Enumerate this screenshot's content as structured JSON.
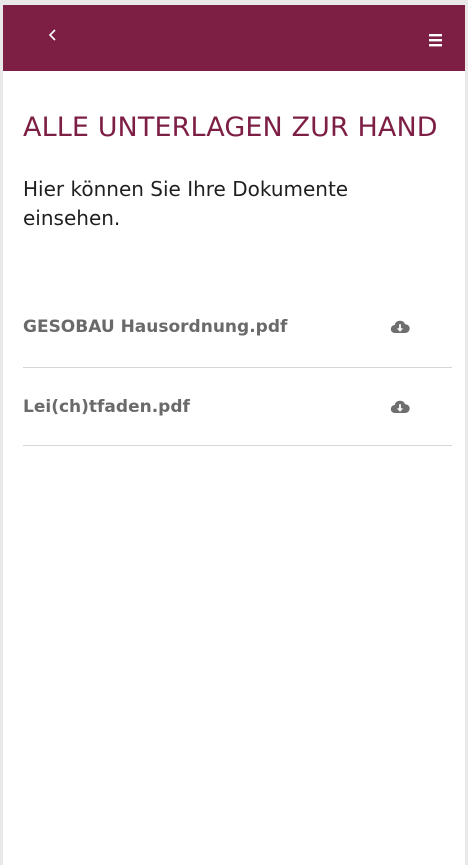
{
  "header": {
    "back_icon": "chevron-left-icon",
    "menu_icon": "hamburger-menu-icon",
    "bar_color": "#7d1f45"
  },
  "page": {
    "title": "ALLE UNTERLAGEN ZUR HAND",
    "intro": "Hier können Sie Ihre Dokumente einsehen."
  },
  "documents": [
    {
      "name": "GESOBAU Hausordnung.pdf",
      "icon": "cloud-download-icon"
    },
    {
      "name": "Lei(ch)tfaden.pdf",
      "icon": "cloud-download-icon"
    }
  ]
}
